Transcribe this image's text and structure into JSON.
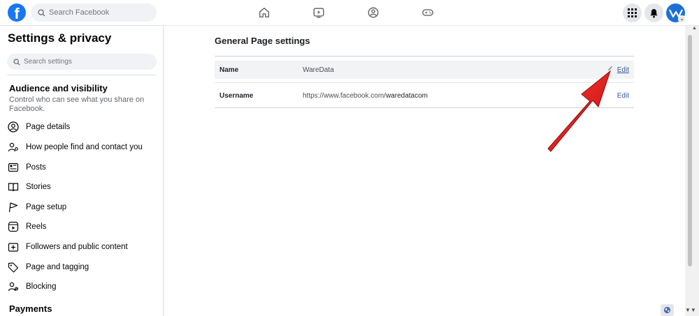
{
  "topbar": {
    "logo_letter": "f",
    "search_placeholder": "Search Facebook",
    "nav_icons": [
      "home-icon",
      "watch-icon",
      "groups-icon",
      "gaming-icon"
    ],
    "right_icons": [
      "menu-grid-icon",
      "notifications-bell-icon",
      "account-avatar"
    ]
  },
  "sidebar": {
    "title": "Settings & privacy",
    "search_placeholder": "Search settings",
    "section1": {
      "title": "Audience and visibility",
      "description": "Control who can see what you share on Facebook."
    },
    "items": [
      {
        "label": "Page details",
        "icon": "user-circle-icon"
      },
      {
        "label": "How people find and contact you",
        "icon": "user-settings-icon"
      },
      {
        "label": "Posts",
        "icon": "posts-icon"
      },
      {
        "label": "Stories",
        "icon": "book-icon"
      },
      {
        "label": "Page setup",
        "icon": "flag-icon"
      },
      {
        "label": "Reels",
        "icon": "reels-icon"
      },
      {
        "label": "Followers and public content",
        "icon": "add-box-icon"
      },
      {
        "label": "Page and tagging",
        "icon": "tag-icon"
      },
      {
        "label": "Blocking",
        "icon": "user-block-icon"
      }
    ],
    "section2": {
      "title": "Payments"
    }
  },
  "main": {
    "title": "General Page settings",
    "rows": [
      {
        "label": "Name",
        "value_prefix": "WareData",
        "value_bold": "",
        "edit": "Edit"
      },
      {
        "label": "Username",
        "value_prefix": "https://www.facebook.com/",
        "value_bold": "waredatacom",
        "edit": "Edit"
      }
    ]
  },
  "colors": {
    "brand_blue": "#1877f2",
    "link_blue": "#365899",
    "arrow_red": "#e8141b"
  }
}
